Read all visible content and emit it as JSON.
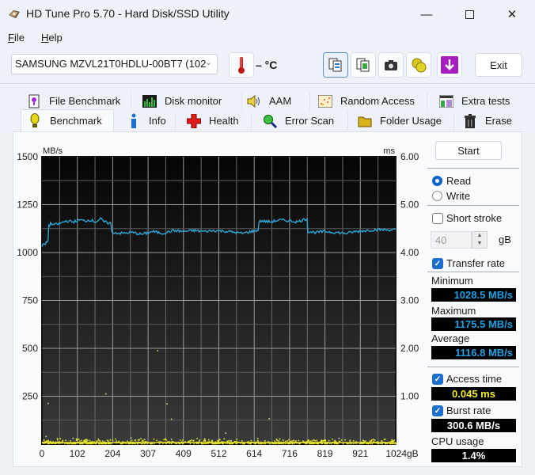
{
  "window": {
    "title": "HD Tune Pro 5.70 - Hard Disk/SSD Utility",
    "controls": {
      "minimize": "—",
      "maximize": "☐",
      "close": "✕"
    }
  },
  "menu": [
    {
      "label": "File",
      "accel": "F",
      "rest": "ile"
    },
    {
      "label": "Help",
      "accel": "H",
      "rest": "elp"
    }
  ],
  "toolbar": {
    "drive": "SAMSUNG MZVL21T0HDLU-00BT7 (102",
    "temperature": "– °C",
    "icons": [
      "thermometer-icon",
      "copy-text-icon",
      "copy-screenshot-icon",
      "camera-icon",
      "coins-icon",
      "download-icon"
    ],
    "exit_label": "Exit"
  },
  "tabs": {
    "row1": [
      {
        "label": "File Benchmark",
        "icon": "file-benchmark-icon"
      },
      {
        "label": "Disk monitor",
        "icon": "disk-monitor-icon"
      },
      {
        "label": "AAM",
        "icon": "speaker-icon"
      },
      {
        "label": "Random Access",
        "icon": "random-access-icon"
      },
      {
        "label": "Extra tests",
        "icon": "extra-tests-icon"
      }
    ],
    "row2": [
      {
        "label": "Benchmark",
        "icon": "lightbulb-icon",
        "selected": true
      },
      {
        "label": "Info",
        "icon": "info-icon"
      },
      {
        "label": "Health",
        "icon": "health-cross-icon"
      },
      {
        "label": "Error Scan",
        "icon": "magnifier-icon"
      },
      {
        "label": "Folder Usage",
        "icon": "folder-icon"
      },
      {
        "label": "Erase",
        "icon": "trash-icon"
      }
    ]
  },
  "side": {
    "start_label": "Start",
    "read_label": "Read",
    "write_label": "Write",
    "mode": "Read",
    "short_stroke_label": "Short stroke",
    "short_stroke_checked": false,
    "short_stroke_value": "40",
    "short_stroke_unit": "gB",
    "transfer_rate_label": "Transfer rate",
    "transfer_rate_checked": true,
    "minimum_label": "Minimum",
    "minimum_value": "1028.5 MB/s",
    "maximum_label": "Maximum",
    "maximum_value": "1175.5 MB/s",
    "average_label": "Average",
    "average_value": "1116.8 MB/s",
    "access_time_label": "Access time",
    "access_time_checked": true,
    "access_time_value": "0.045 ms",
    "burst_rate_label": "Burst rate",
    "burst_rate_checked": true,
    "burst_rate_value": "300.6 MB/s",
    "cpu_label": "CPU usage",
    "cpu_value": "1.4%"
  },
  "chart_data": {
    "type": "line",
    "title": "",
    "ylabel": "MB/s",
    "y2label": "ms",
    "xlabel": "gB",
    "ylim": [
      0,
      1500
    ],
    "y2lim": [
      0,
      6
    ],
    "xlim": [
      0,
      1024
    ],
    "yticks": [
      "1500",
      "1250",
      "1000",
      "750",
      "500",
      "250"
    ],
    "y2ticks": [
      "6.00",
      "5.00",
      "4.00",
      "3.00",
      "2.00",
      "1.00"
    ],
    "xticks": [
      "0",
      "102",
      "204",
      "307",
      "409",
      "512",
      "614",
      "716",
      "819",
      "921",
      "1024gB"
    ],
    "grid": true,
    "colors": {
      "transfer": "#2ea6d6",
      "access": "#e8e62a",
      "background": "#0b0b0b",
      "grid": "#8a8a8a"
    },
    "series": [
      {
        "name": "Transfer rate (MB/s)",
        "x": [
          0,
          5,
          10,
          15,
          20,
          25,
          35,
          50,
          70,
          90,
          110,
          125,
          140,
          155,
          170,
          180,
          190,
          205,
          230,
          260,
          290,
          320,
          350,
          380,
          410,
          440,
          470,
          500,
          540,
          580,
          620,
          628,
          635,
          660,
          690,
          720,
          740,
          755,
          765,
          770,
          790,
          820,
          850,
          880,
          910,
          940,
          970,
          1000,
          1024
        ],
        "values": [
          1030,
          1045,
          1040,
          1060,
          1140,
          1150,
          1145,
          1150,
          1165,
          1160,
          1170,
          1165,
          1170,
          1160,
          1175,
          1160,
          1155,
          1105,
          1100,
          1105,
          1095,
          1110,
          1100,
          1115,
          1110,
          1115,
          1110,
          1115,
          1110,
          1100,
          1115,
          1160,
          1165,
          1160,
          1170,
          1165,
          1160,
          1170,
          1175,
          1110,
          1105,
          1110,
          1105,
          1100,
          1110,
          1115,
          1120,
          1118,
          1120
        ]
      },
      {
        "name": "Access time (ms)",
        "note": "dense band of points mostly between 0.03 and 0.10 ms across full range, few outliers",
        "outliers": [
          {
            "x": 12,
            "y": 0.16
          },
          {
            "x": 18,
            "y": 0.85
          },
          {
            "x": 90,
            "y": 0.12
          },
          {
            "x": 185,
            "y": 1.05
          },
          {
            "x": 258,
            "y": 0.13
          },
          {
            "x": 335,
            "y": 1.95
          },
          {
            "x": 362,
            "y": 0.84
          },
          {
            "x": 375,
            "y": 0.52
          },
          {
            "x": 375,
            "y": 0.1
          },
          {
            "x": 532,
            "y": 0.23
          },
          {
            "x": 658,
            "y": 0.53
          },
          {
            "x": 860,
            "y": 0.12
          }
        ]
      }
    ]
  }
}
